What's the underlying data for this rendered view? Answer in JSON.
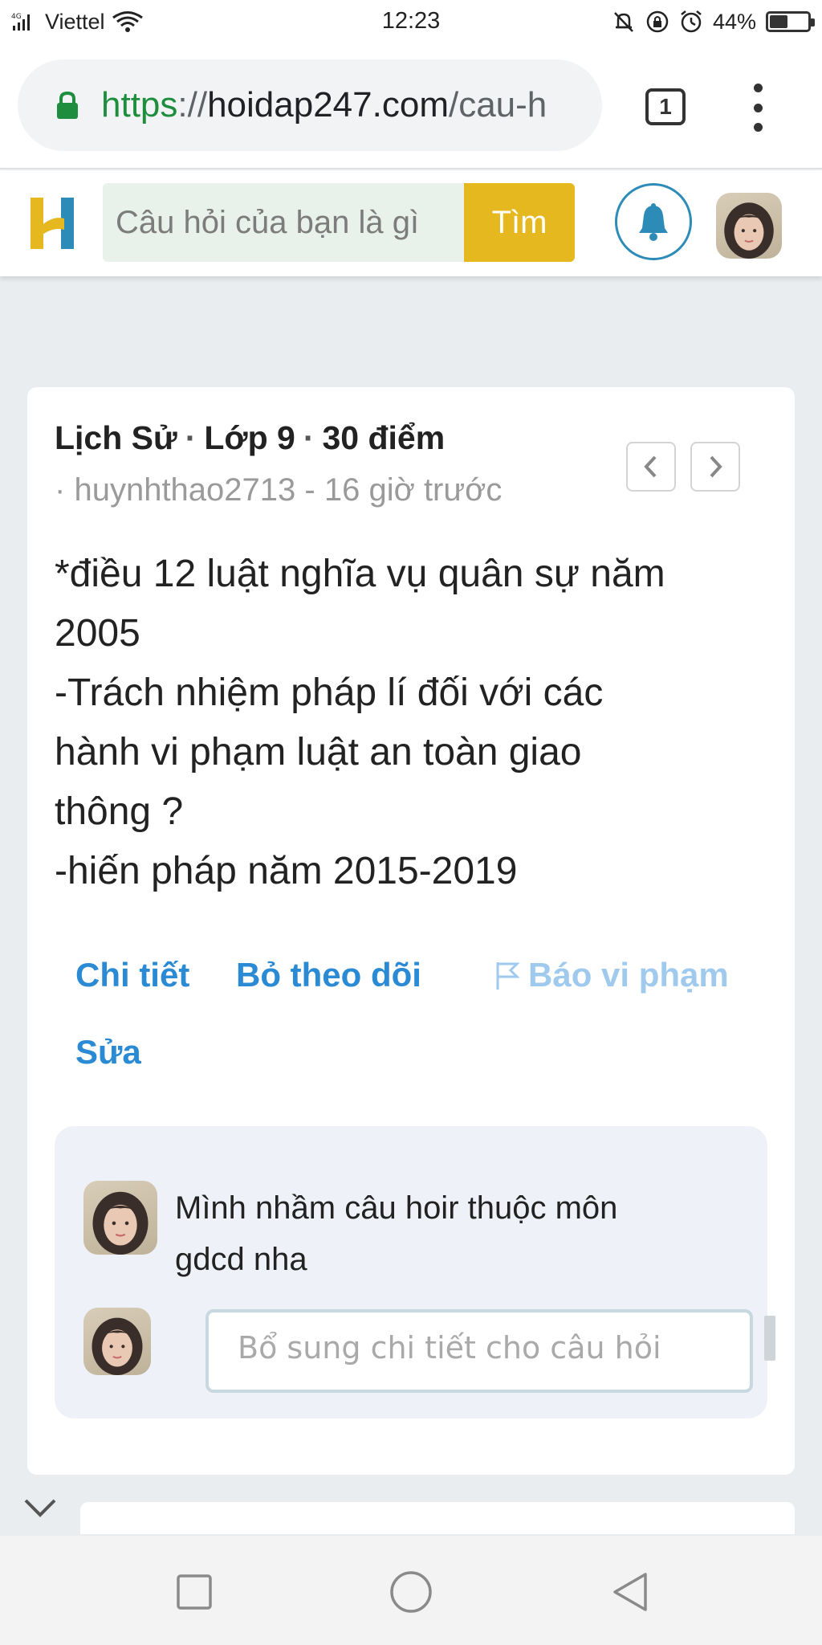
{
  "status_bar": {
    "network": "4G",
    "carrier": "Viettel",
    "time": "12:23",
    "battery": "44%",
    "battery_level": 0.44
  },
  "browser": {
    "url_scheme": "https",
    "url_separator": "://",
    "url_host": "hoidap247.com",
    "url_path": "/cau-h",
    "tab_count": "1"
  },
  "site_header": {
    "search_placeholder": "Câu hỏi của bạn là gì",
    "search_button": "Tìm"
  },
  "question": {
    "subject": "Lịch Sử",
    "grade": "Lớp 9",
    "points": "30 điểm",
    "author": "huynhthao2713",
    "time_ago": "16 giờ trước",
    "body_lines": [
      "*điều 12 luật nghĩa vụ quân sự năm",
      "2005",
      "-Trách nhiệm pháp lí đối với các",
      "hành vi phạm luật an toàn giao",
      "thông ?",
      "-hiến pháp năm  2015-2019"
    ],
    "actions": {
      "detail": "Chi tiết",
      "unfollow": "Bỏ theo dõi",
      "report": "Báo vi phạm",
      "edit": "Sửa"
    },
    "comments": [
      {
        "text_lines": [
          "Mình nhầm câu hoir thuộc môn",
          "gdcd nha"
        ]
      }
    ],
    "reply_placeholder": "Bổ sung chi tiết cho câu hỏi"
  },
  "colors": {
    "brand_yellow": "#e5b81f",
    "brand_blue": "#2c8bb7",
    "link_blue": "#2b8ad4",
    "report_blue": "#9fcaee",
    "page_bg": "#e9edf0"
  },
  "icons": {
    "lock": "lock-icon",
    "bell": "bell-icon",
    "flag": "flag-icon",
    "prev": "chevron-left-icon",
    "next": "chevron-right-icon",
    "collapse": "chevron-down-icon",
    "recent": "square-icon",
    "home": "circle-icon",
    "back": "triangle-back-icon"
  }
}
